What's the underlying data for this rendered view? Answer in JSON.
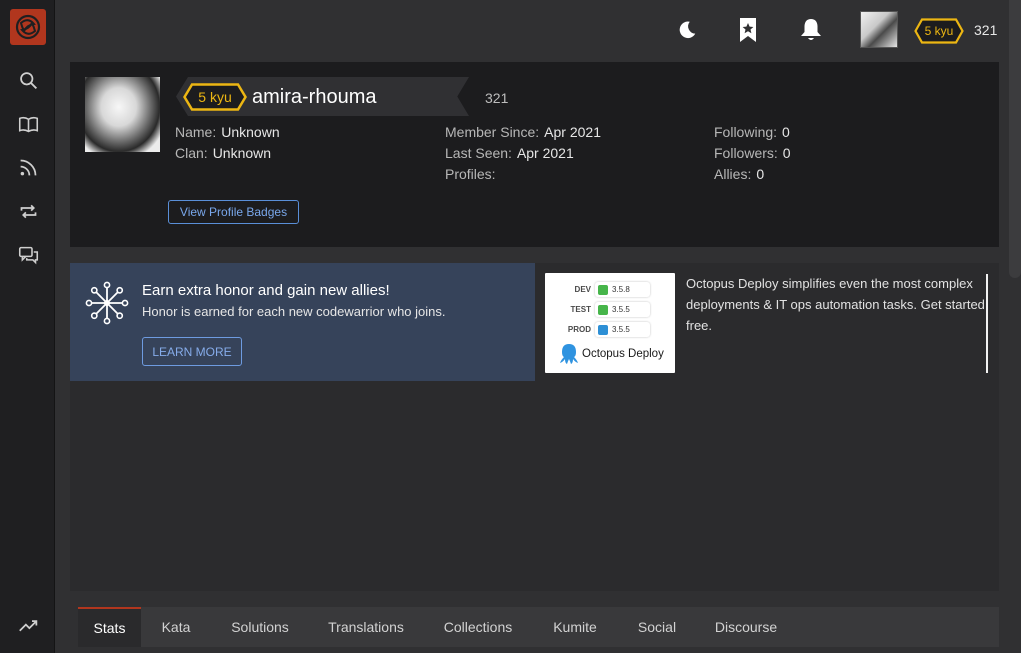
{
  "colors": {
    "brand": "#b1361e",
    "rank": "#ecb613",
    "link": "#79a7eb",
    "honor_panel": "#36435a"
  },
  "sidebar": {
    "logo_icon": "codewars-logo-icon",
    "items": [
      {
        "icon": "search-icon"
      },
      {
        "icon": "book-icon"
      },
      {
        "icon": "rss-icon"
      },
      {
        "icon": "repeat-icon"
      },
      {
        "icon": "chat-icon"
      }
    ],
    "bottom_icon": "trending-icon"
  },
  "topbar": {
    "kyu": "5 kyu",
    "honor": "321",
    "icons": [
      "moon-icon",
      "bookmark-star-icon",
      "bell-icon"
    ]
  },
  "profile": {
    "kyu": "5 kyu",
    "username": "amira-rhouma",
    "honor": "321",
    "name_label": "Name:",
    "name_value": "Unknown",
    "clan_label": "Clan:",
    "clan_value": "Unknown",
    "member_label": "Member Since:",
    "member_value": "Apr 2021",
    "seen_label": "Last Seen:",
    "seen_value": "Apr 2021",
    "profiles_label": "Profiles:",
    "following_label": "Following:",
    "following_value": "0",
    "followers_label": "Followers:",
    "followers_value": "0",
    "allies_label": "Allies:",
    "allies_value": "0",
    "badges_button": "View Profile Badges"
  },
  "honor_promo": {
    "title": "Earn extra honor and gain new allies!",
    "subtitle": "Honor is earned for each new codewarrior who joins.",
    "button": "LEARN MORE"
  },
  "ad": {
    "envs": [
      {
        "label": "DEV",
        "version": "3.5.8",
        "status": "ok"
      },
      {
        "label": "TEST",
        "version": "3.5.5",
        "status": "ok"
      },
      {
        "label": "PROD",
        "version": "3.5.5",
        "status": "pending"
      }
    ],
    "brand": "Octopus Deploy",
    "text": "Octopus Deploy simplifies even the most complex deployments & IT ops automation tasks. Get started free."
  },
  "tabs": [
    {
      "label": "Stats",
      "active": true
    },
    {
      "label": "Kata"
    },
    {
      "label": "Solutions"
    },
    {
      "label": "Translations"
    },
    {
      "label": "Collections"
    },
    {
      "label": "Kumite"
    },
    {
      "label": "Social"
    },
    {
      "label": "Discourse"
    }
  ]
}
